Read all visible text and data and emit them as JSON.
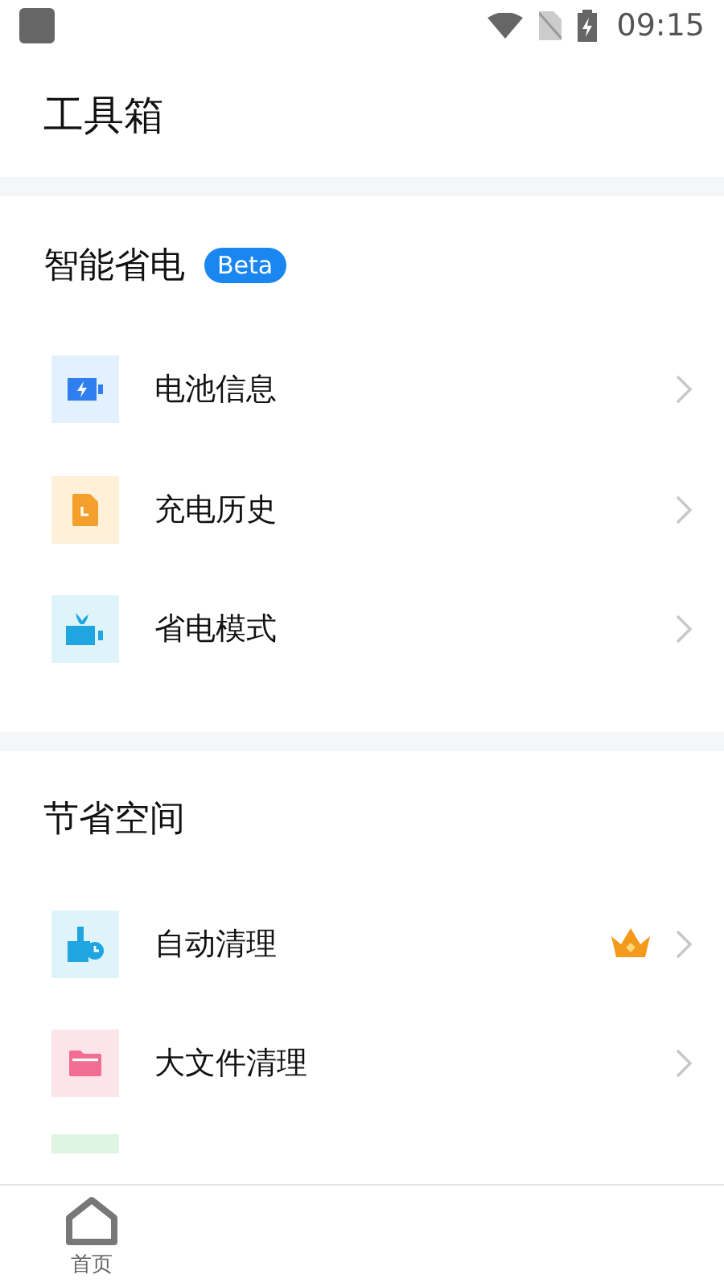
{
  "status_bar": {
    "time": "09:15"
  },
  "title": "工具箱",
  "sections": [
    {
      "title": "智能省电",
      "badge": "Beta",
      "items": [
        {
          "kind": "battery",
          "label": "电池信息",
          "premium": false
        },
        {
          "kind": "history",
          "label": "充电历史",
          "premium": false
        },
        {
          "kind": "saver",
          "label": "省电模式",
          "premium": false
        }
      ]
    },
    {
      "title": "节省空间",
      "items": [
        {
          "kind": "clean",
          "label": "自动清理",
          "premium": true
        },
        {
          "kind": "folder",
          "label": "大文件清理",
          "premium": false
        }
      ]
    }
  ],
  "nav": [
    {
      "label": "首页",
      "selected": true
    }
  ]
}
